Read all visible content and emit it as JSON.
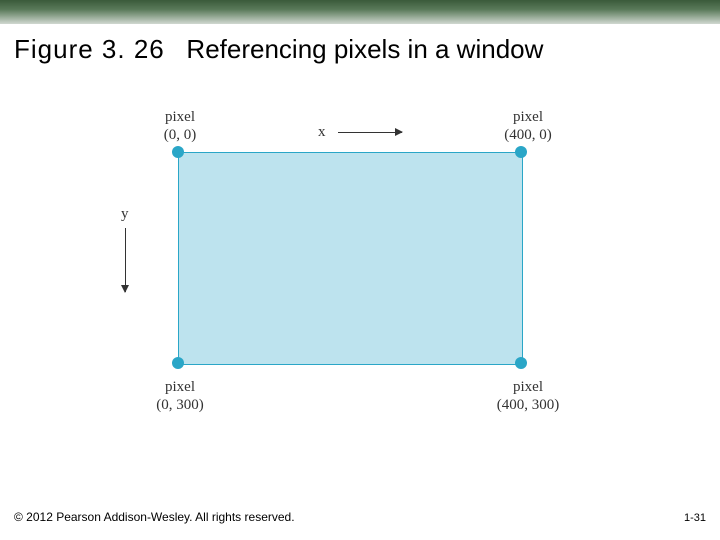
{
  "title_prefix": "Figure 3. 26",
  "title_text": "Referencing pixels in a window",
  "axes": {
    "x": "x",
    "y": "y"
  },
  "pixel_word": "pixel",
  "corners": {
    "tl": "(0, 0)",
    "tr": "(400, 0)",
    "bl": "(0, 300)",
    "br": "(400, 300)"
  },
  "footer": "© 2012 Pearson Addison-Wesley. All rights reserved.",
  "page_number": "1-31"
}
